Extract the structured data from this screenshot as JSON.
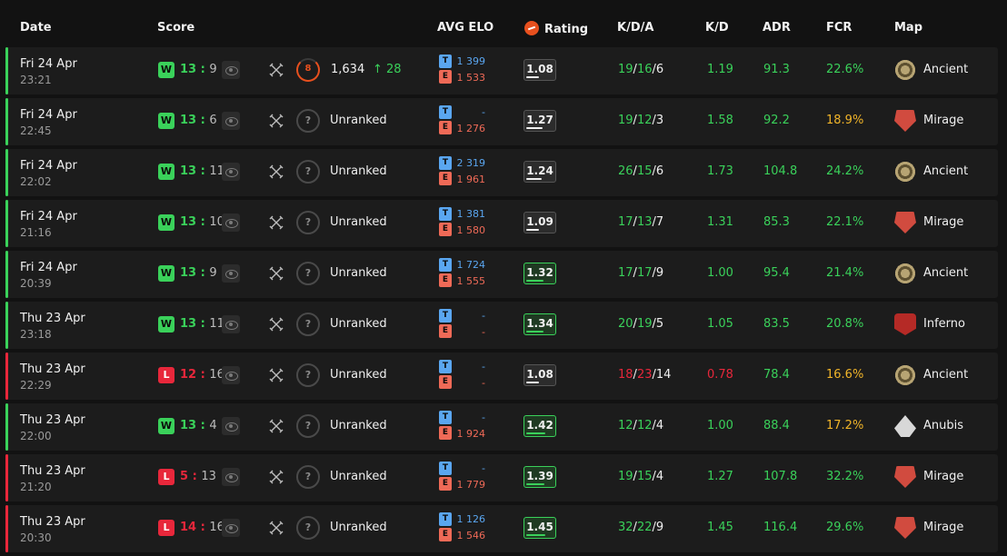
{
  "header": {
    "date": "Date",
    "score": "Score",
    "avg_elo": "AVG ELO",
    "rating": "Rating",
    "kda": "K/D/A",
    "kd": "K/D",
    "adr": "ADR",
    "fcr": "FCR",
    "map": "Map"
  },
  "colors": {
    "win": "#3ad15a",
    "loss": "#e8273b",
    "team": "#5aa6f0",
    "enemy": "#ef6a57",
    "warning": "#f0b429",
    "elo_accent": "#e8501e"
  },
  "matches": [
    {
      "result": "W",
      "date": "Fri 24 Apr",
      "time": "23:21",
      "score_mine": "13",
      "score_theirs": "9",
      "level": "8",
      "elo": "1,634",
      "elo_change": "↑ 28",
      "ranked": true,
      "elo_t": "1 399",
      "elo_e": "1 533",
      "rating": "1.08",
      "rating_fill": 0.45,
      "k": "19",
      "d": "16",
      "a": "6",
      "kd": "1.19",
      "adr": "91.3",
      "fcr": "22.6%",
      "map": "Ancient",
      "map_icon": "ancient-map-icon"
    },
    {
      "result": "W",
      "date": "Fri 24 Apr",
      "time": "22:45",
      "score_mine": "13",
      "score_theirs": "6",
      "level": "?",
      "elo": "Unranked",
      "elo_change": "",
      "ranked": false,
      "elo_t": "-",
      "elo_e": "1 276",
      "rating": "1.27",
      "rating_fill": 0.55,
      "k": "19",
      "d": "12",
      "a": "3",
      "kd": "1.58",
      "adr": "92.2",
      "fcr": "18.9%",
      "map": "Mirage",
      "map_icon": "mirage-map-icon"
    },
    {
      "result": "W",
      "date": "Fri 24 Apr",
      "time": "22:02",
      "score_mine": "13",
      "score_theirs": "11",
      "level": "?",
      "elo": "Unranked",
      "elo_change": "",
      "ranked": false,
      "elo_t": "2 319",
      "elo_e": "1 961",
      "rating": "1.24",
      "rating_fill": 0.53,
      "k": "26",
      "d": "15",
      "a": "6",
      "kd": "1.73",
      "adr": "104.8",
      "fcr": "24.2%",
      "map": "Ancient",
      "map_icon": "ancient-map-icon"
    },
    {
      "result": "W",
      "date": "Fri 24 Apr",
      "time": "21:16",
      "score_mine": "13",
      "score_theirs": "10",
      "level": "?",
      "elo": "Unranked",
      "elo_change": "",
      "ranked": false,
      "elo_t": "1 381",
      "elo_e": "1 580",
      "rating": "1.09",
      "rating_fill": 0.45,
      "k": "17",
      "d": "13",
      "a": "7",
      "kd": "1.31",
      "adr": "85.3",
      "fcr": "22.1%",
      "map": "Mirage",
      "map_icon": "mirage-map-icon"
    },
    {
      "result": "W",
      "date": "Fri 24 Apr",
      "time": "20:39",
      "score_mine": "13",
      "score_theirs": "9",
      "level": "?",
      "elo": "Unranked",
      "elo_change": "",
      "ranked": false,
      "elo_t": "1 724",
      "elo_e": "1 555",
      "rating": "1.32",
      "rating_fill": 0.58,
      "k": "17",
      "d": "17",
      "a": "9",
      "kd": "1.00",
      "adr": "95.4",
      "fcr": "21.4%",
      "map": "Ancient",
      "map_icon": "ancient-map-icon"
    },
    {
      "result": "W",
      "date": "Thu 23 Apr",
      "time": "23:18",
      "score_mine": "13",
      "score_theirs": "11",
      "level": "?",
      "elo": "Unranked",
      "elo_change": "",
      "ranked": false,
      "elo_t": "-",
      "elo_e": "-",
      "rating": "1.34",
      "rating_fill": 0.6,
      "k": "20",
      "d": "19",
      "a": "5",
      "kd": "1.05",
      "adr": "83.5",
      "fcr": "20.8%",
      "map": "Inferno",
      "map_icon": "inferno-map-icon"
    },
    {
      "result": "L",
      "date": "Thu 23 Apr",
      "time": "22:29",
      "score_mine": "12",
      "score_theirs": "16",
      "level": "?",
      "elo": "Unranked",
      "elo_change": "",
      "ranked": false,
      "elo_t": "-",
      "elo_e": "-",
      "rating": "1.08",
      "rating_fill": 0.45,
      "k": "18",
      "d": "23",
      "a": "14",
      "kd": "0.78",
      "adr": "78.4",
      "fcr": "16.6%",
      "map": "Ancient",
      "map_icon": "ancient-map-icon"
    },
    {
      "result": "W",
      "date": "Thu 23 Apr",
      "time": "22:00",
      "score_mine": "13",
      "score_theirs": "4",
      "level": "?",
      "elo": "Unranked",
      "elo_change": "",
      "ranked": false,
      "elo_t": "-",
      "elo_e": "1 924",
      "rating": "1.42",
      "rating_fill": 0.65,
      "k": "12",
      "d": "12",
      "a": "4",
      "kd": "1.00",
      "adr": "88.4",
      "fcr": "17.2%",
      "map": "Anubis",
      "map_icon": "anubis-map-icon"
    },
    {
      "result": "L",
      "date": "Thu 23 Apr",
      "time": "21:20",
      "score_mine": "5",
      "score_theirs": "13",
      "level": "?",
      "elo": "Unranked",
      "elo_change": "",
      "ranked": false,
      "elo_t": "-",
      "elo_e": "1 779",
      "rating": "1.39",
      "rating_fill": 0.63,
      "k": "19",
      "d": "15",
      "a": "4",
      "kd": "1.27",
      "adr": "107.8",
      "fcr": "32.2%",
      "map": "Mirage",
      "map_icon": "mirage-map-icon"
    },
    {
      "result": "L",
      "date": "Thu 23 Apr",
      "time": "20:30",
      "score_mine": "14",
      "score_theirs": "16",
      "level": "?",
      "elo": "Unranked",
      "elo_change": "",
      "ranked": false,
      "elo_t": "1 126",
      "elo_e": "1 546",
      "rating": "1.45",
      "rating_fill": 0.67,
      "k": "32",
      "d": "22",
      "a": "9",
      "kd": "1.45",
      "adr": "116.4",
      "fcr": "29.6%",
      "map": "Mirage",
      "map_icon": "mirage-map-icon"
    }
  ]
}
